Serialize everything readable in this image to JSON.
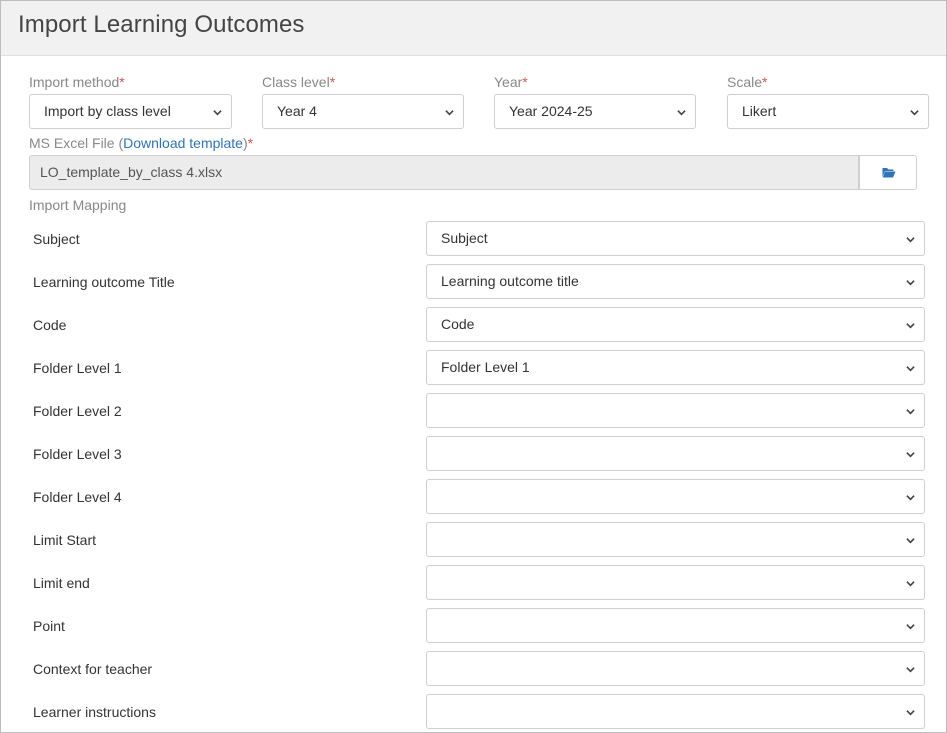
{
  "title": "Import Learning Outcomes",
  "fields": [
    {
      "label": "Import method",
      "required": "*",
      "value": "Import by class level"
    },
    {
      "label": "Class level",
      "required": "*",
      "value": "Year 4"
    },
    {
      "label": "Year",
      "required": "*",
      "value": "Year 2024-25"
    },
    {
      "label": "Scale",
      "required": "*",
      "value": "Likert"
    }
  ],
  "file": {
    "label": "MS Excel File (",
    "link": "Download template",
    "label_end": ")",
    "required": "*",
    "value": "LO_template_by_class 4.xlsx",
    "browse_icon": "folder-open-icon"
  },
  "mapping": {
    "heading": "Import Mapping",
    "rows": [
      {
        "label": "Subject",
        "value": "Subject"
      },
      {
        "label": "Learning outcome Title",
        "value": "Learning outcome title"
      },
      {
        "label": "Code",
        "value": "Code"
      },
      {
        "label": "Folder Level 1",
        "value": "Folder Level 1"
      },
      {
        "label": "Folder Level 2",
        "value": ""
      },
      {
        "label": "Folder Level 3",
        "value": ""
      },
      {
        "label": "Folder Level 4",
        "value": ""
      },
      {
        "label": "Limit Start",
        "value": ""
      },
      {
        "label": "Limit end",
        "value": ""
      },
      {
        "label": "Point",
        "value": ""
      },
      {
        "label": "Context for teacher",
        "value": ""
      },
      {
        "label": "Learner instructions",
        "value": ""
      }
    ]
  },
  "colors": {
    "required": "#d9534f",
    "link": "#2f74b5",
    "header_bg": "#f1f1f1"
  }
}
